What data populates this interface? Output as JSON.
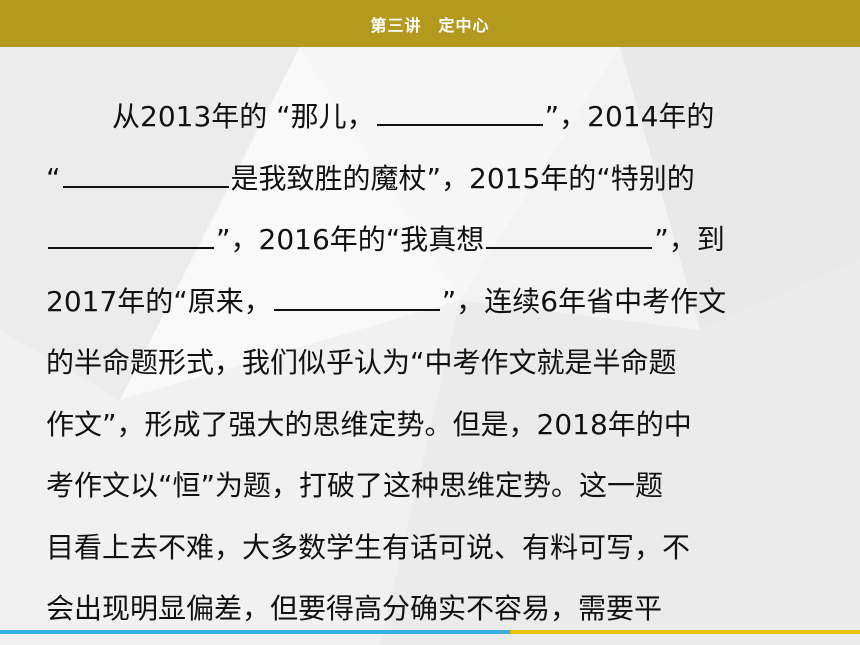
{
  "header": {
    "title": "第三讲　定中心"
  },
  "colors": {
    "header_bar": "#b39a1f",
    "bottom_line_left": "#3ab0e0",
    "bottom_line_right": "#e6c200"
  },
  "body": {
    "lines": [
      {
        "segments": [
          {
            "text": "从2013年的 “那儿，"
          },
          {
            "blank": true
          },
          {
            "text": "”，2014年的"
          }
        ]
      },
      {
        "segments": [
          {
            "text": "“"
          },
          {
            "blank": true
          },
          {
            "text": "是我致胜的魔杖”，2015年的“特别的"
          }
        ]
      },
      {
        "segments": [
          {
            "blank": true
          },
          {
            "text": "”，2016年的“我真想"
          },
          {
            "blank": true
          },
          {
            "text": "”，到"
          }
        ]
      },
      {
        "segments": [
          {
            "text": "2017年的“原来，"
          },
          {
            "blank": true
          },
          {
            "text": "”，连续6年省中考作文"
          }
        ]
      },
      {
        "segments": [
          {
            "text": "的半命题形式，我们似乎认为“中考作文就是半命题"
          }
        ]
      },
      {
        "segments": [
          {
            "text": "作文”，形成了强大的思维定势。但是，2018年的中"
          }
        ]
      },
      {
        "segments": [
          {
            "text": "考作文以“恒”为题，打破了这种思维定势。这一题"
          }
        ]
      },
      {
        "segments": [
          {
            "text": "目看上去不难，大多数学生有话可说、有料可写，不"
          }
        ]
      },
      {
        "segments": [
          {
            "text": "会出现明显偏差，但要得高分确实不容易，需要平"
          }
        ]
      }
    ]
  }
}
